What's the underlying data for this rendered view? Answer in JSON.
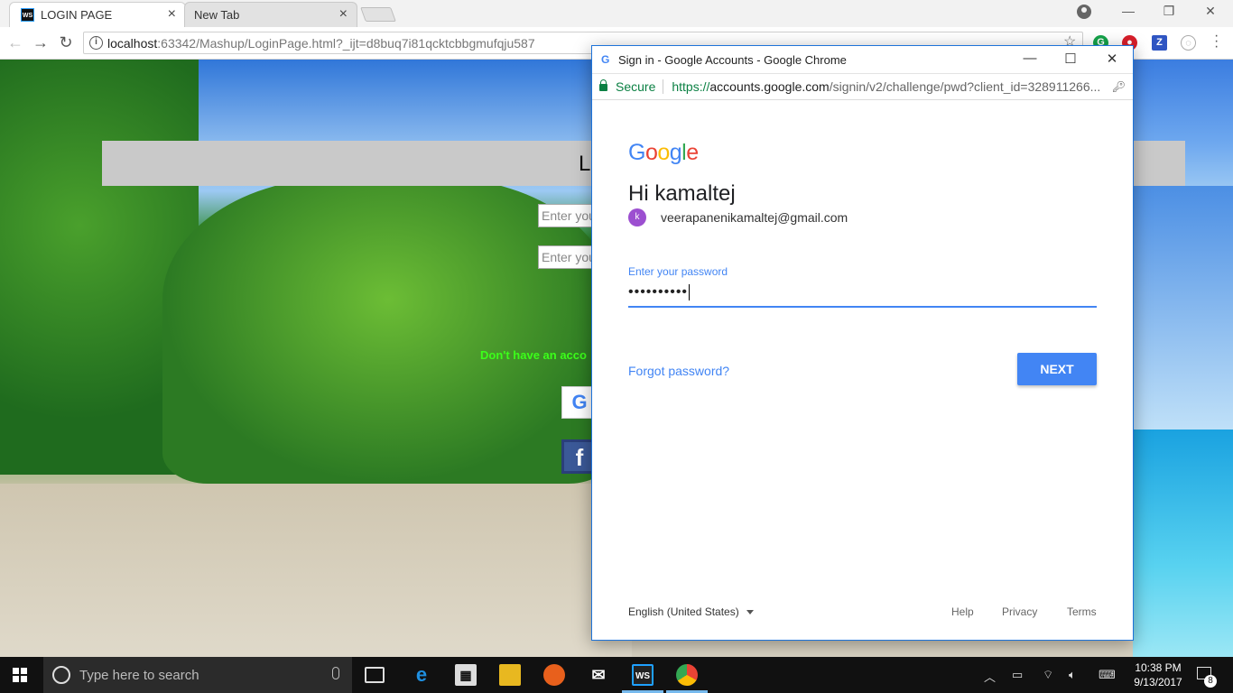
{
  "browser": {
    "tabs": [
      {
        "label": "LOGIN PAGE",
        "favicon": "WS",
        "active": true
      },
      {
        "label": "New Tab",
        "active": false
      }
    ],
    "url_host": "localhost",
    "url_rest": ":63342/Mashup/LoginPage.html?_ijt=d8buq7i81qcktcbbgmufqju587"
  },
  "page": {
    "header_title": "LO",
    "input1_placeholder": "Enter you",
    "input2_placeholder": "Enter you",
    "signup_text": "Don't have an acco",
    "google_btn": "G",
    "facebook_btn": "f"
  },
  "popup": {
    "window_title": "Sign in - Google Accounts - Google Chrome",
    "secure_label": "Secure",
    "url_scheme": "https://",
    "url_host": "accounts.google.com",
    "url_rest": "/signin/v2/challenge/pwd?client_id=328911266...",
    "logo": [
      "G",
      "o",
      "o",
      "g",
      "l",
      "e"
    ],
    "greeting": "Hi kamaltej",
    "avatar_initial": "k",
    "email": "veerapanenikamaltej@gmail.com",
    "password_label": "Enter your password",
    "password_value": "••••••••••",
    "forgot_password": "Forgot password?",
    "next_button": "NEXT",
    "footer": {
      "language": "English (United States)",
      "help": "Help",
      "privacy": "Privacy",
      "terms": "Terms"
    }
  },
  "taskbar": {
    "search_placeholder": "Type here to search",
    "time": "10:38 PM",
    "date": "9/13/2017",
    "notification_count": "8"
  },
  "colors": {
    "google_blue": "#4285f4",
    "secure_green": "#0b8043",
    "popup_border": "#1e73d9"
  }
}
